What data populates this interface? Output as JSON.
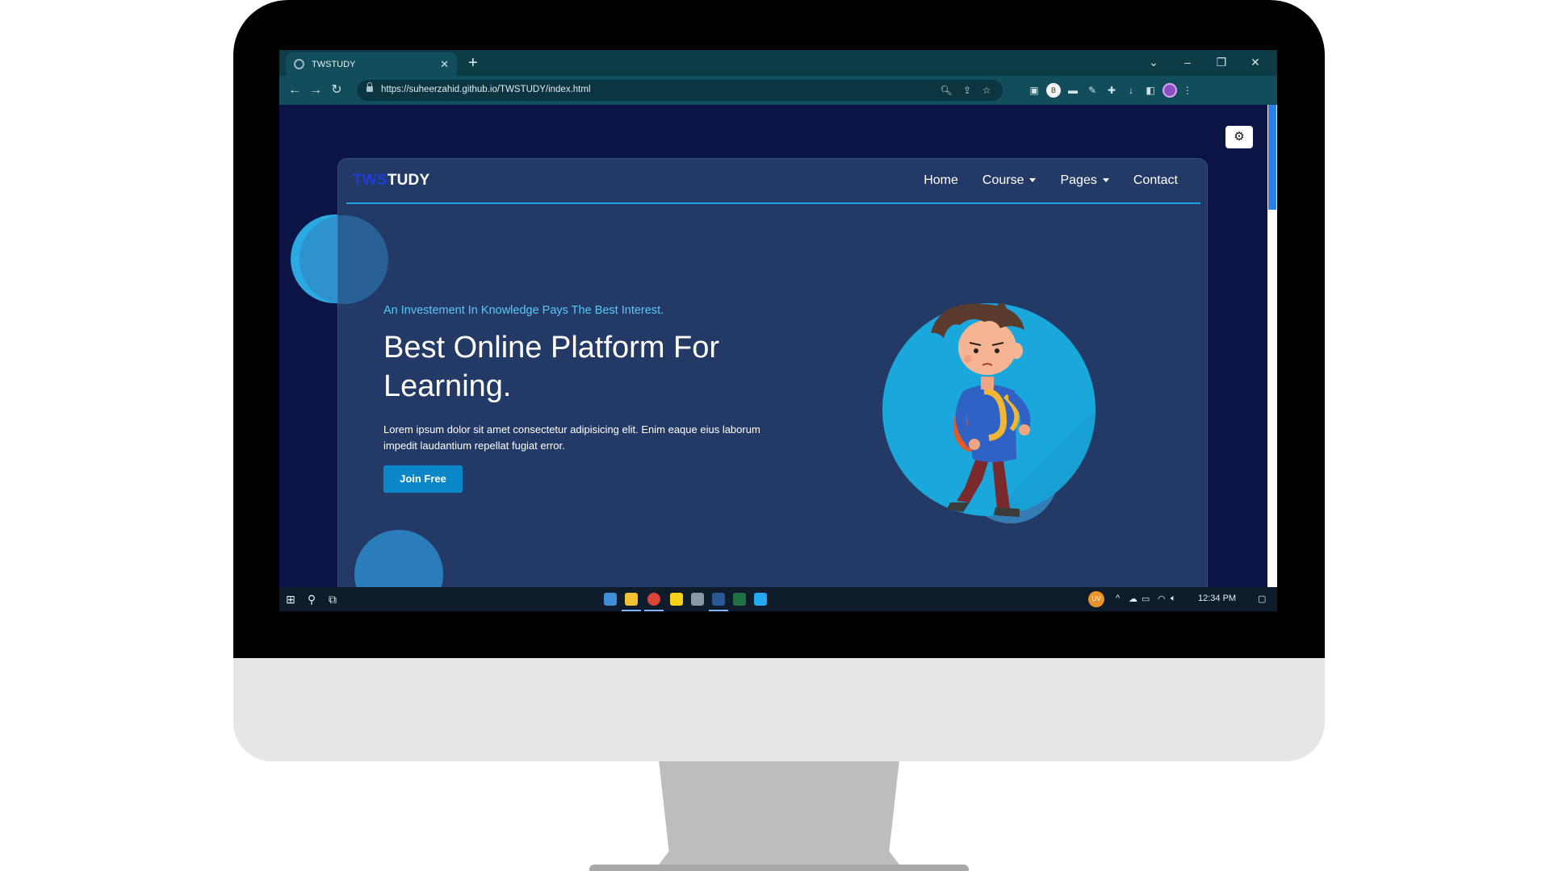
{
  "browser": {
    "tab_title": "TWSTUDY",
    "tab_close": "✕",
    "new_tab": "+",
    "url": "https://suheerzahid.github.io/TWSTUDY/index.html",
    "window_controls": {
      "dropdown": "⌄",
      "minimize": "–",
      "restore": "❐",
      "close": "✕"
    }
  },
  "site": {
    "brand_prefix": "TWS",
    "brand_suffix": "TUDY",
    "nav": {
      "home": "Home",
      "course": "Course",
      "pages": "Pages",
      "contact": "Contact"
    },
    "hero": {
      "tagline": "An Investement In Knowledge Pays The Best Interest.",
      "title": "Best Online Platform For Learning.",
      "text": "Lorem ipsum dolor sit amet consectetur adipisicing elit. Enim eaque eius laborum impedit laudantium repellat fugiat error.",
      "cta": "Join Free"
    },
    "settings_icon": "⚙"
  },
  "taskbar": {
    "clock": "12:34 PM",
    "user_badge": "UV"
  },
  "colors": {
    "accent": "#1da1e0",
    "page_bg": "#0c1445",
    "card_bg": "#233a66",
    "button": "#0b86c9",
    "tagline": "#56c8f5",
    "brand_prefix": "#1d3ed8"
  }
}
